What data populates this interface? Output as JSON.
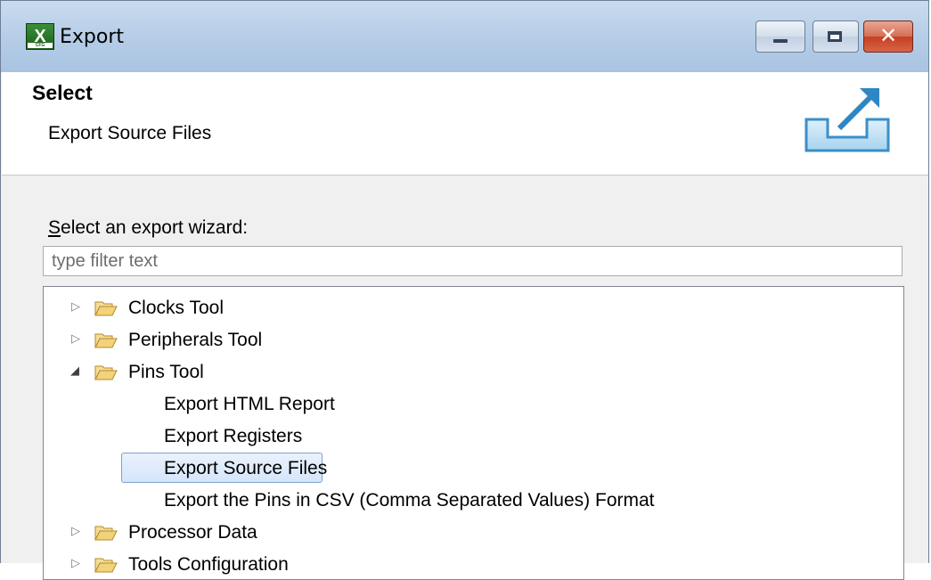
{
  "window": {
    "title": "Export",
    "icon": "x-app-icon",
    "icon_letter": "X",
    "icon_sub": "CFG",
    "close_glyph": "✕"
  },
  "header": {
    "title": "Select",
    "description": "Export Source Files",
    "icon": "export-arrow-icon"
  },
  "wizard": {
    "prompt_accel": "S",
    "prompt_rest": "elect an export wizard:",
    "filter_placeholder": "type filter text",
    "filter_value": ""
  },
  "tree": {
    "items": [
      {
        "label": "Clocks Tool",
        "type": "folder",
        "expanded": false
      },
      {
        "label": "Peripherals Tool",
        "type": "folder",
        "expanded": false
      },
      {
        "label": "Pins Tool",
        "type": "folder",
        "expanded": true
      },
      {
        "label": "Export HTML Report",
        "type": "leaf"
      },
      {
        "label": "Export Registers",
        "type": "leaf"
      },
      {
        "label": "Export Source Files",
        "type": "leaf",
        "selected": true
      },
      {
        "label": "Export the Pins in CSV (Comma Separated Values) Format",
        "type": "leaf"
      },
      {
        "label": "Processor Data",
        "type": "folder",
        "expanded": false
      },
      {
        "label": "Tools Configuration",
        "type": "folder",
        "expanded": false
      }
    ]
  },
  "colors": {
    "selection_border": "#7da2ce",
    "selection_fill": "#d5e5f9",
    "folder": "#e8c66a"
  }
}
